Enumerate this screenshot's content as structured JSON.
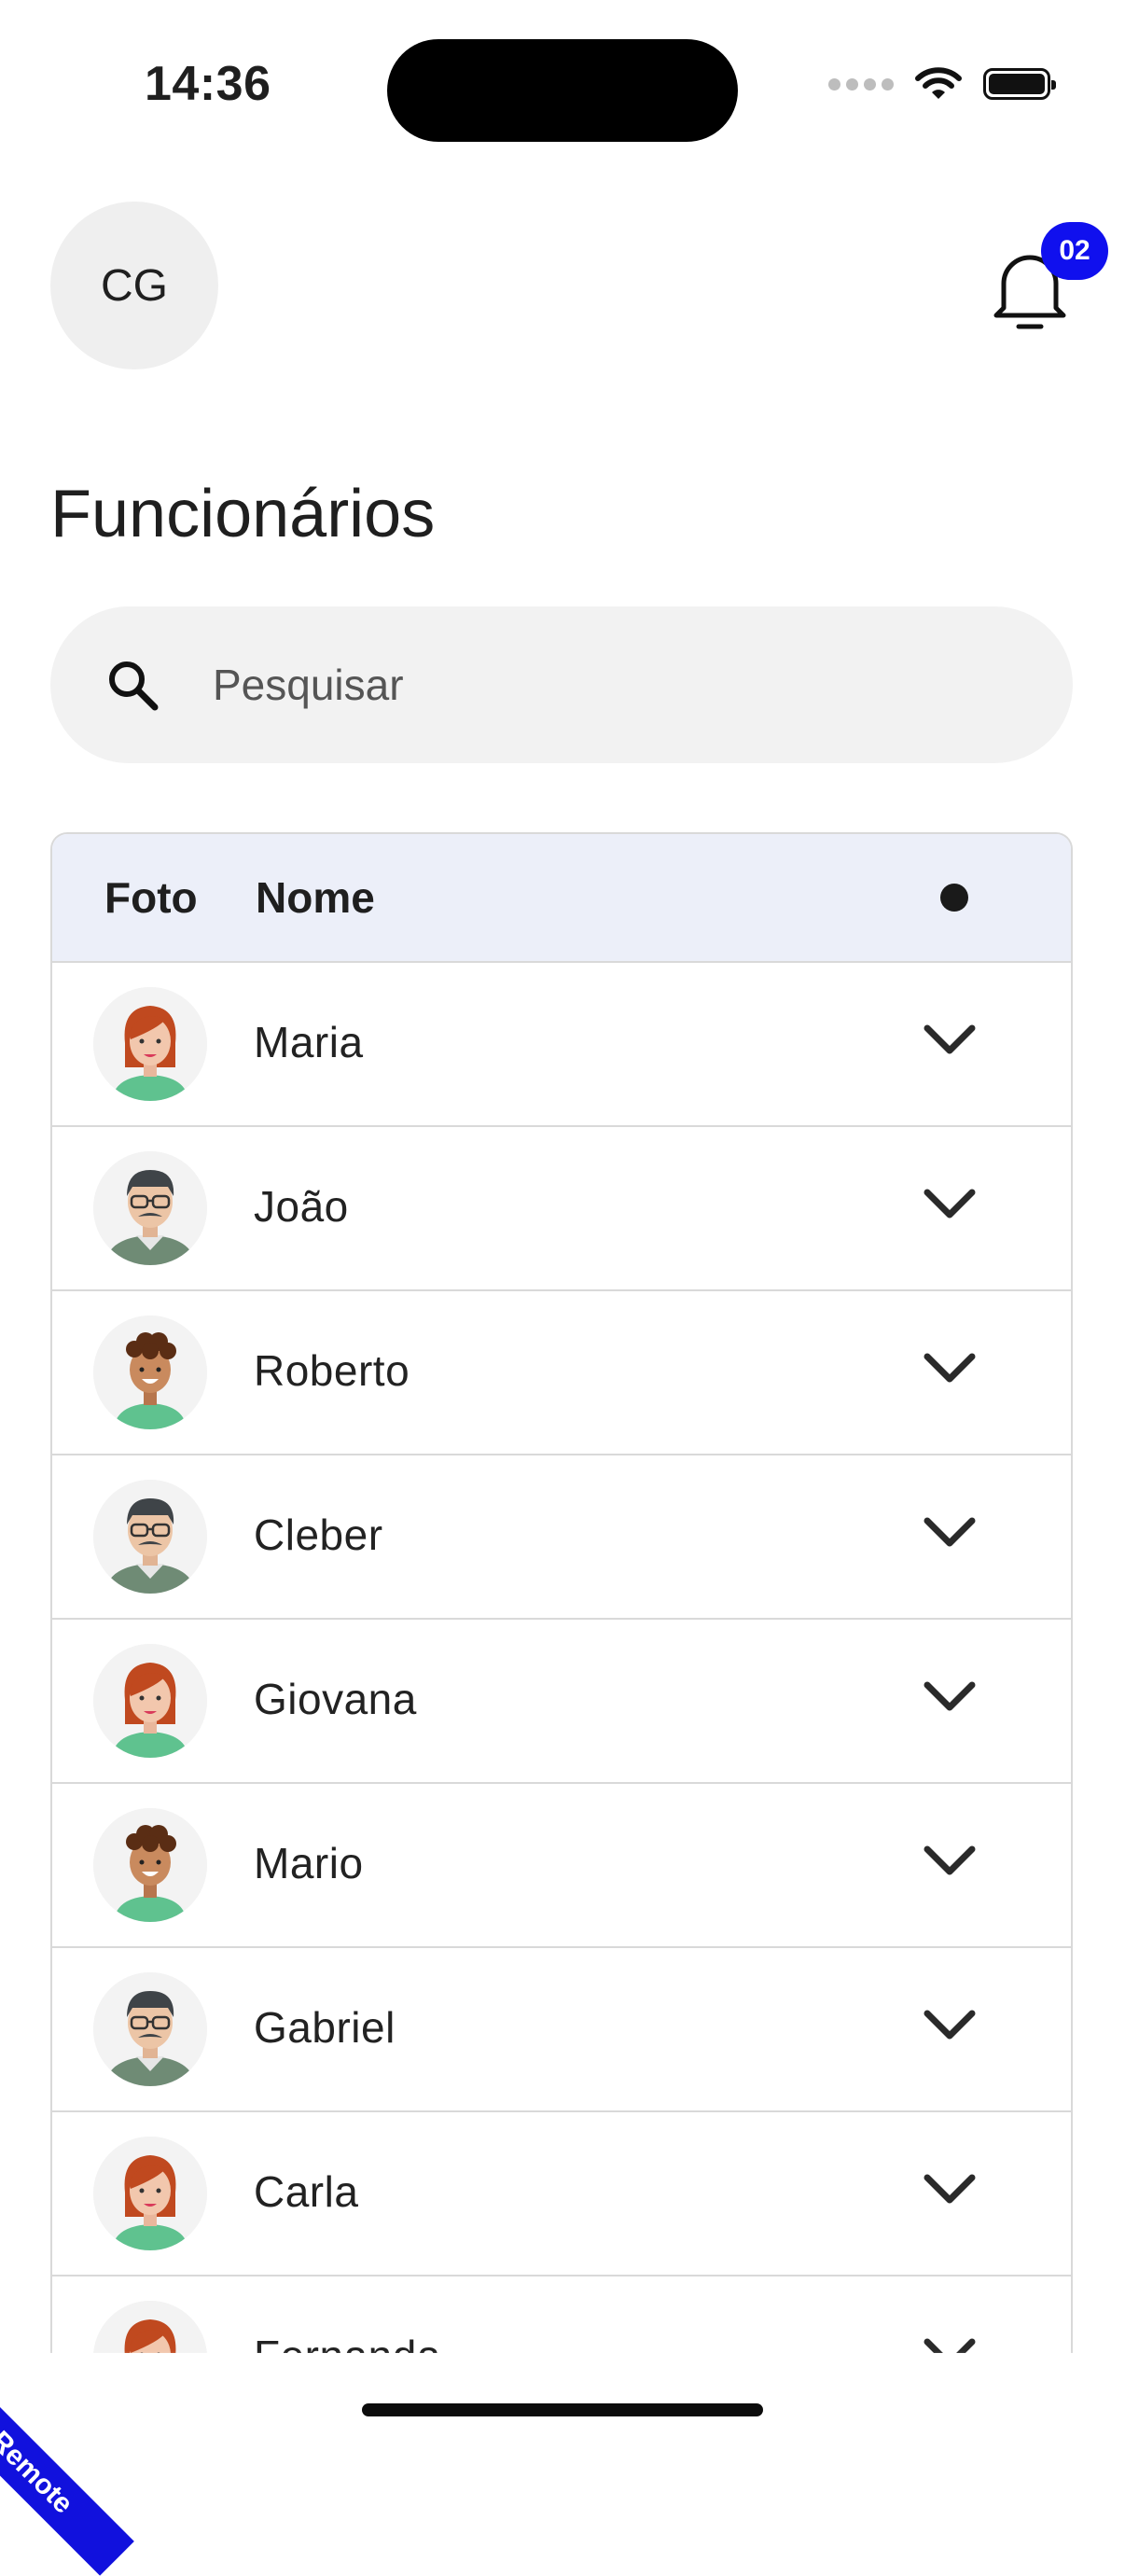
{
  "status_bar": {
    "time": "14:36"
  },
  "header": {
    "avatar_initials": "CG",
    "notification_count": "02"
  },
  "page_title": "Funcionários",
  "search": {
    "placeholder": "Pesquisar",
    "value": ""
  },
  "table": {
    "columns": {
      "photo": "Foto",
      "name": "Nome"
    },
    "rows": [
      {
        "name": "Maria",
        "avatar": "woman-redhair-icon"
      },
      {
        "name": "João",
        "avatar": "man-glasses-mustache-icon"
      },
      {
        "name": "Roberto",
        "avatar": "boy-curly-hair-icon"
      },
      {
        "name": "Cleber",
        "avatar": "man-glasses-mustache-icon"
      },
      {
        "name": "Giovana",
        "avatar": "woman-redhair-icon"
      },
      {
        "name": "Mario",
        "avatar": "boy-curly-hair-icon"
      },
      {
        "name": "Gabriel",
        "avatar": "man-glasses-mustache-icon"
      },
      {
        "name": "Carla",
        "avatar": "woman-redhair-icon"
      },
      {
        "name": "Fernanda",
        "avatar": "woman-redhair-icon"
      }
    ]
  },
  "ribbon_label": "Remote",
  "colors": {
    "accent": "#1010ee",
    "table_header_bg": "#eceff9",
    "search_bg": "#f2f2f2"
  }
}
